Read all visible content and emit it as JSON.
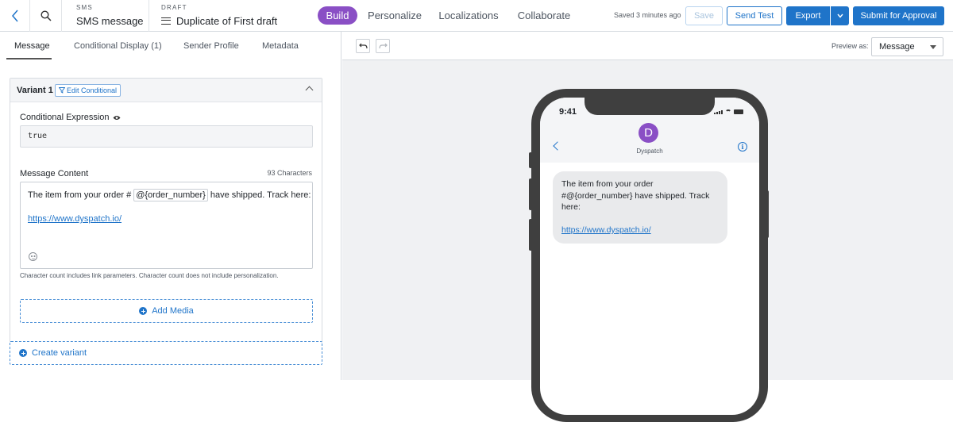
{
  "topbar": {
    "type_label": "SMS",
    "type_value": "SMS message",
    "status_label": "DRAFT",
    "draft_name": "Duplicate of First draft",
    "nav_tabs": [
      {
        "label": "Build",
        "active": true
      },
      {
        "label": "Personalize"
      },
      {
        "label": "Localizations"
      },
      {
        "label": "Collaborate"
      }
    ],
    "saved_text": "Saved 3 minutes ago",
    "save_label": "Save",
    "send_test_label": "Send Test",
    "export_label": "Export",
    "submit_label": "Submit for Approval"
  },
  "editor": {
    "tabs": [
      {
        "label": "Message",
        "active": true
      },
      {
        "label": "Conditional Display (1)"
      },
      {
        "label": "Sender Profile"
      },
      {
        "label": "Metadata"
      }
    ],
    "variant": {
      "title": "Variant 1",
      "edit_conditional_label": "Edit Conditional",
      "conditional_expression_label": "Conditional Expression",
      "conditional_expression_value": "true",
      "message_content_label": "Message Content",
      "char_count": "93 Characters",
      "message_before_token": "The item from your order #",
      "token": "@{order_number}",
      "message_after_token": "have shipped. Track here:",
      "message_link": "https://www.dyspatch.io/",
      "hint": "Character count includes link parameters. Character count does not include personalization.",
      "add_media_label": "Add Media"
    },
    "create_variant_label": "Create variant"
  },
  "preview": {
    "preview_as_label": "Preview as:",
    "preview_as_value": "Message",
    "phone": {
      "time": "9:41",
      "avatar_letter": "D",
      "sender_name": "Dyspatch",
      "bubble_line1": "The item from your order",
      "bubble_line2": "#@{order_number} have shipped. Track",
      "bubble_line3": "here:",
      "bubble_link": "https://www.dyspatch.io/"
    }
  },
  "colors": {
    "accent_purple": "#8a4fc5",
    "primary_blue": "#1f74c9",
    "panel_gray": "#f0f1f3"
  },
  "icons": [
    "chevron-left-icon",
    "search-icon",
    "menu-icon",
    "chevron-down-icon",
    "filter-icon",
    "chevron-up-icon",
    "eye-icon",
    "emoji-icon",
    "plus-circle-icon",
    "undo-icon",
    "redo-icon",
    "signal-icon",
    "wifi-icon",
    "battery-icon",
    "info-icon"
  ]
}
